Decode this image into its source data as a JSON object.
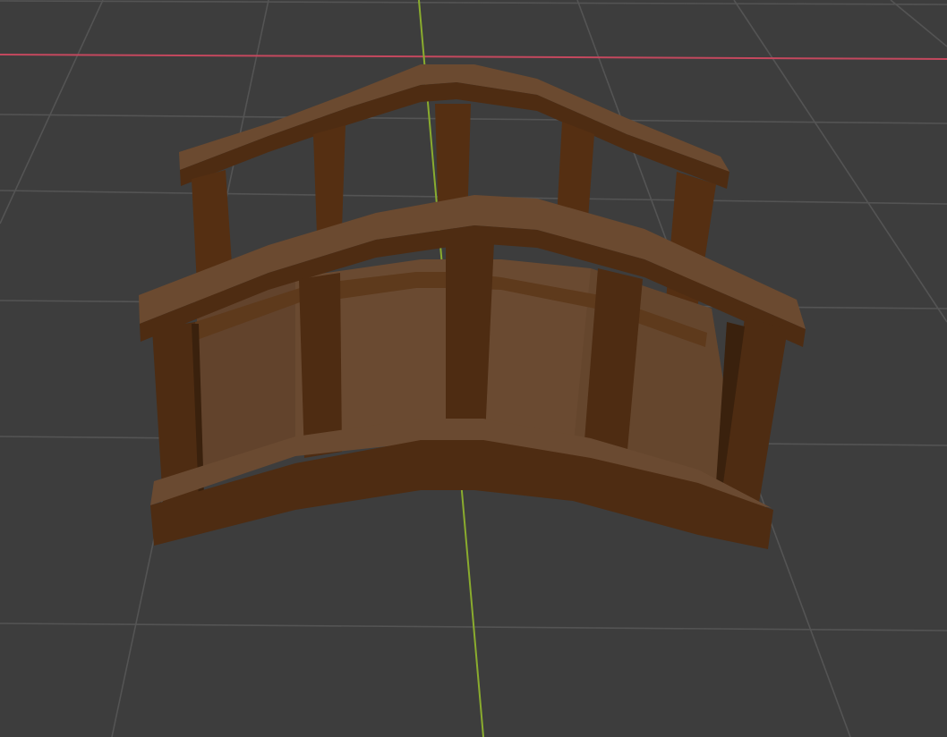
{
  "viewport": {
    "background_color": "#3d3d3d",
    "grid_line_color": "#545454",
    "x_axis_color": "#c4485e",
    "y_axis_color": "#8aac2e"
  },
  "model": {
    "wood_light": "#6b4a30",
    "wood_mid": "#5e3a1c",
    "wood_dark": "#4e2c12",
    "wood_shadow": "#3a210d"
  }
}
